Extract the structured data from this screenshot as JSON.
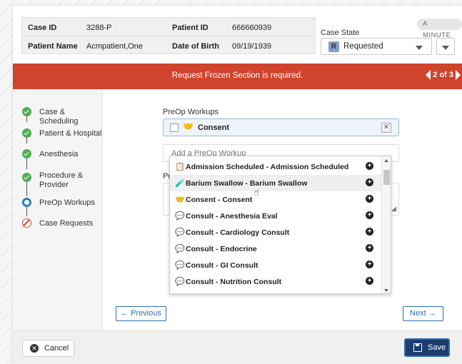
{
  "header": {
    "case_id_label": "Case ID",
    "case_id": "3288-P",
    "patient_id_label": "Patient ID",
    "patient_id": "666660939",
    "patient_name_label": "Patient Name",
    "patient_name": "Acmpatient,One",
    "dob_label": "Date of Birth",
    "dob": "09/19/1939",
    "time_badge": "A MINUTE",
    "case_state_label": "Case State",
    "case_state_badge": "R",
    "case_state_value": "Requested"
  },
  "alert": {
    "message": "Request Frozen Section is required.",
    "pager": "2 of 3",
    "color": "#d0432c"
  },
  "sidebar": {
    "steps": [
      {
        "label": "Case & Scheduling",
        "status": "done"
      },
      {
        "label": "Patient & Hospital",
        "status": "done"
      },
      {
        "label": "Anesthesia",
        "status": "done"
      },
      {
        "label": "Procedure & Provider",
        "status": "done"
      },
      {
        "label": "PreOp Workups",
        "status": "current"
      },
      {
        "label": "Case Requests",
        "status": "blocked"
      }
    ]
  },
  "main": {
    "preop_label": "PreOp Workups",
    "selected_workup": "Consent",
    "selected_icon": "handshake-icon",
    "add_placeholder": "Add a PreOp Workup",
    "second_label_partial": "Pr",
    "dropdown_items": [
      {
        "icon": "clipboard-icon",
        "label": "Admission Scheduled - Admission Scheduled"
      },
      {
        "icon": "barium-icon",
        "label": "Barium Swallow - Barium Swallow"
      },
      {
        "icon": "handshake-icon",
        "label": "Consent - Consent"
      },
      {
        "icon": "comments-icon",
        "label": "Consult - Anesthesia Eval"
      },
      {
        "icon": "comments-icon",
        "label": "Consult - Cardiology Consult"
      },
      {
        "icon": "comments-icon",
        "label": "Consult - Endocrine"
      },
      {
        "icon": "comments-icon",
        "label": "Consult - GI Consult"
      },
      {
        "icon": "comments-icon",
        "label": "Consult - Nutrition Consult"
      }
    ],
    "previous_label": "Previous",
    "next_label": "Next"
  },
  "footer": {
    "cancel_label": "Cancel",
    "save_label": "Save",
    "save_color": "#1d3d6e"
  }
}
